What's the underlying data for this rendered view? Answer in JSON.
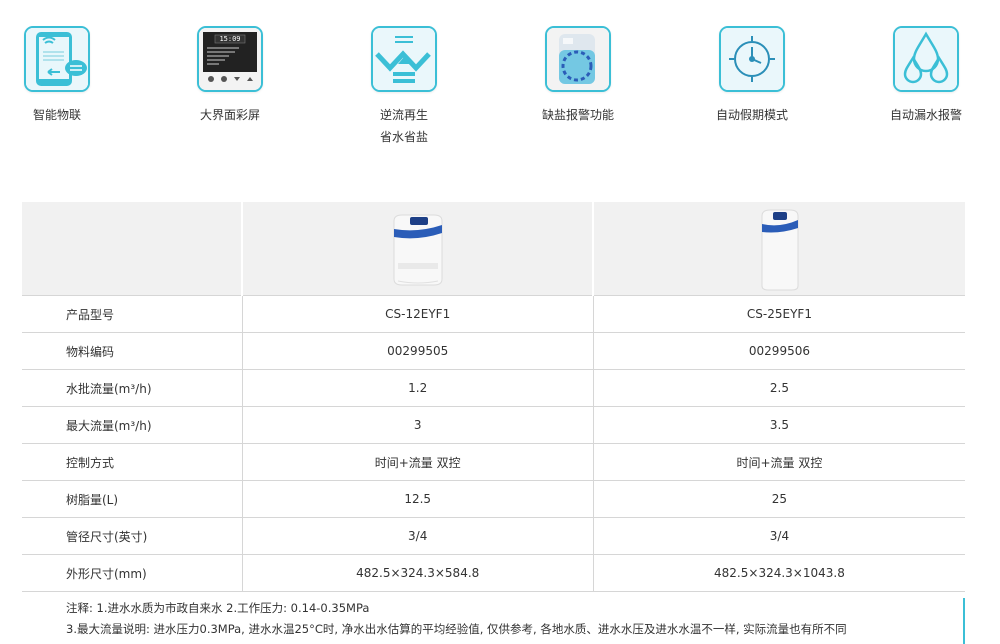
{
  "features": [
    {
      "label": "智能物联",
      "icon": "smart-iot-icon"
    },
    {
      "label": "大界面彩屏",
      "icon": "color-screen-icon",
      "screen_time": "15:09"
    },
    {
      "label": "逆流再生\n省水省盐",
      "icon": "counterflow-icon"
    },
    {
      "label": "缺盐报警功能",
      "icon": "salt-alarm-icon"
    },
    {
      "label": "自动假期模式",
      "icon": "holiday-mode-icon"
    },
    {
      "label": "自动漏水报警",
      "icon": "leak-alarm-icon"
    }
  ],
  "table": {
    "rows": [
      {
        "label": "产品型号",
        "values": [
          "CS-12EYF1",
          "CS-25EYF1"
        ]
      },
      {
        "label": "物料编码",
        "values": [
          "00299505",
          "00299506"
        ]
      },
      {
        "label": "水批流量(m³/h)",
        "values": [
          "1.2",
          "2.5"
        ]
      },
      {
        "label": "最大流量(m³/h)",
        "values": [
          "3",
          "3.5"
        ]
      },
      {
        "label": "控制方式",
        "values": [
          "时间+流量 双控",
          "时间+流量 双控"
        ]
      },
      {
        "label": "树脂量(L)",
        "values": [
          "12.5",
          "25"
        ]
      },
      {
        "label": "管径尺寸(英寸)",
        "values": [
          "3/4",
          "3/4"
        ]
      },
      {
        "label": "外形尺寸(mm)",
        "values": [
          "482.5×324.3×584.8",
          "482.5×324.3×1043.8"
        ]
      }
    ]
  },
  "notes": [
    "注释: 1.进水水质为市政自来水 2.工作压力: 0.14-0.35MPa",
    "3.最大流量说明: 进水压力0.3MPa, 进水水温25°C时, 净水出水估算的平均经验值, 仅供参考, 各地水质、进水水压及进水水温不一样, 实际流量也有所不同"
  ],
  "colors": {
    "accent": "#3bbfd6",
    "brand_blue": "#2b5db8",
    "row_bg": "#f1f1f1"
  }
}
